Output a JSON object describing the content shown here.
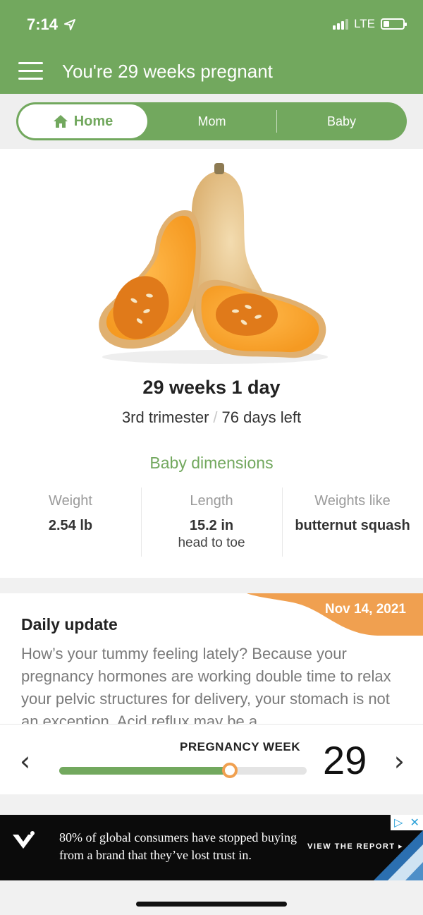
{
  "status_bar": {
    "time": "7:14",
    "network": "LTE",
    "battery_level": 0.3
  },
  "header": {
    "title": "You're 29 weeks pregnant"
  },
  "tabs": [
    {
      "label": "Home",
      "active": true
    },
    {
      "label": "Mom",
      "active": false
    },
    {
      "label": "Baby",
      "active": false
    }
  ],
  "summary": {
    "weeks": "29 weeks 1 day",
    "trimester": "3rd trimester",
    "separator": "/",
    "days_left": "76 days left"
  },
  "dimensions": {
    "title": "Baby dimensions",
    "weight": {
      "label": "Weight",
      "value": "2.54 lb"
    },
    "length": {
      "label": "Length",
      "value": "15.2 in",
      "sub": "head to toe"
    },
    "weights_like": {
      "label": "Weights like",
      "value": "butternut squash"
    }
  },
  "daily_update": {
    "date": "Nov 14, 2021",
    "title": "Daily update",
    "body": "How’s your tummy feeling lately? Because your pregnancy hormones are working double time to relax your pelvic structures for delivery, your stomach is not an exception. Acid reflux may be a"
  },
  "week_selector": {
    "label": "PREGNANCY WEEK",
    "week": "29",
    "progress_fraction": 0.69,
    "prev": "‹",
    "next": "›"
  },
  "ad": {
    "text_line1": "80% of global consumers have stopped buying",
    "text_line2": "from a brand that they’ve lost trust in.",
    "cta": "VIEW THE REPORT ▸",
    "choices_play": "▷",
    "choices_close": "✕"
  },
  "colors": {
    "brand_green": "#72a85e",
    "accent_orange": "#f0a050"
  }
}
